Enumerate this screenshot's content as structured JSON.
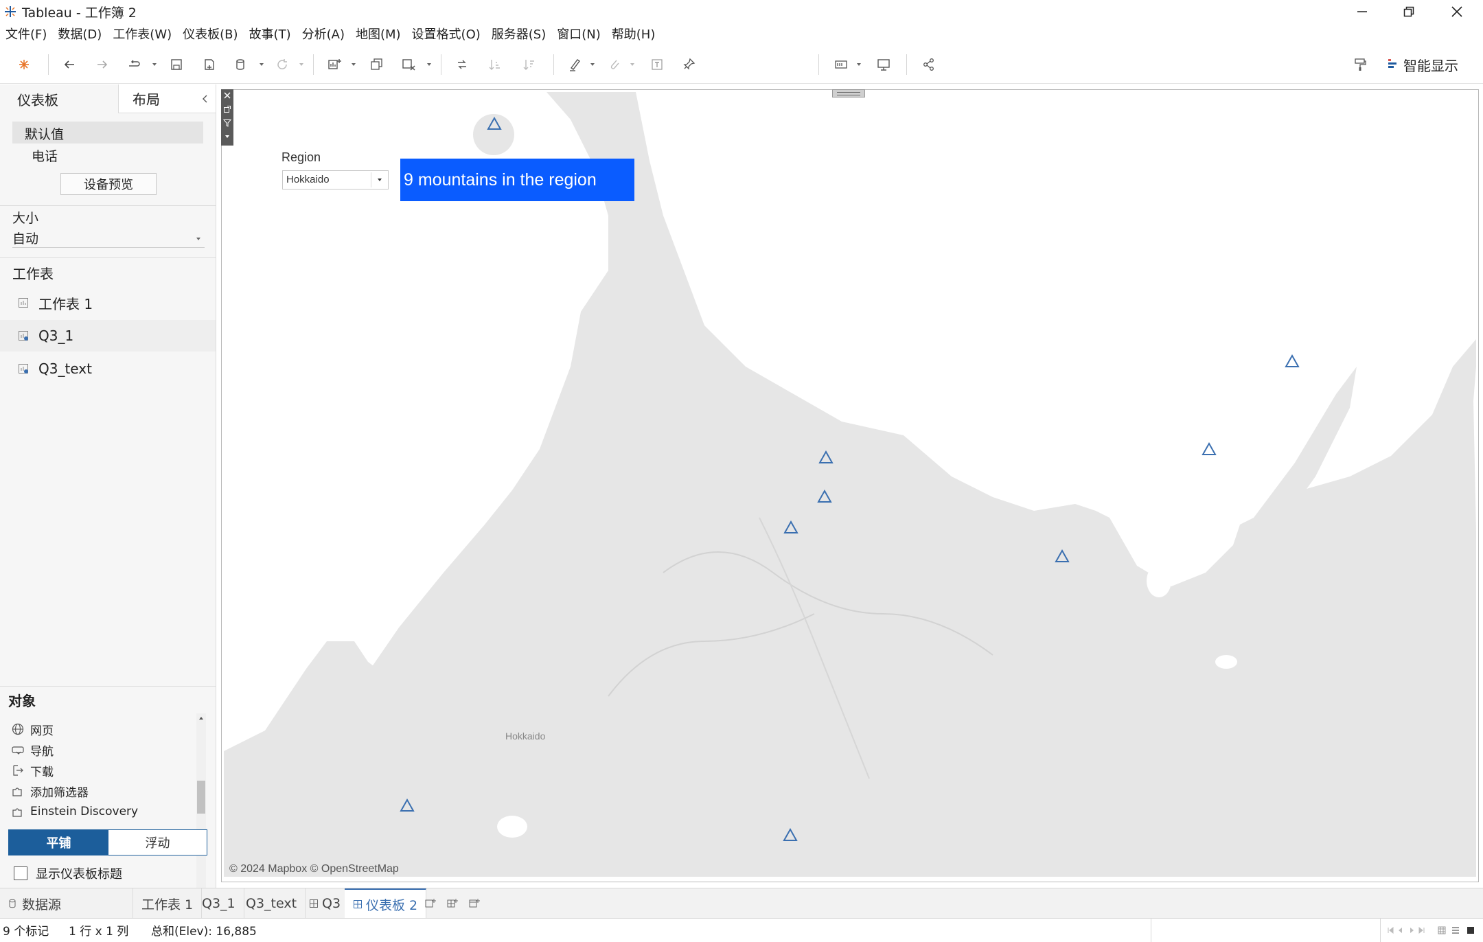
{
  "window": {
    "title": "Tableau - 工作簿 2"
  },
  "menu": [
    "文件(F)",
    "数据(D)",
    "工作表(W)",
    "仪表板(B)",
    "故事(T)",
    "分析(A)",
    "地图(M)",
    "设置格式(O)",
    "服务器(S)",
    "窗口(N)",
    "帮助(H)"
  ],
  "toolbar": {
    "smart_show": "智能显示"
  },
  "left_panel": {
    "tabs": [
      "仪表板",
      "布局"
    ],
    "devices": {
      "default": "默认值",
      "phone": "电话",
      "preview_button": "设备预览"
    },
    "size": {
      "label": "大小",
      "value": "自动"
    },
    "sheets": {
      "header": "工作表",
      "items": [
        "工作表 1",
        "Q3_1",
        "Q3_text"
      ]
    },
    "objects": {
      "header": "对象",
      "items": [
        "网页",
        "导航",
        "下载",
        "添加筛选器",
        "Einstein Discovery"
      ],
      "tiled": "平铺",
      "floating": "浮动",
      "show_title": "显示仪表板标题"
    }
  },
  "dashboard": {
    "filter_label": "Region",
    "filter_value": "Hokkaido",
    "summary_text": "9 mountains in the region",
    "summary_color": "#0a5cff",
    "map_place_label": "Hokkaido",
    "map_attribution": "© 2024 Mapbox © OpenStreetMap",
    "marker_count": 9,
    "marker_color": "#3a6fb0"
  },
  "sheet_tabs": [
    "数据源",
    "工作表 1",
    "Q3_1",
    "Q3_text",
    "Q3",
    "仪表板 2"
  ],
  "status": {
    "marks": "9 个标记",
    "rows_cols": "1 行 x 1 列",
    "sum": "总和(Elev): 16,885"
  }
}
